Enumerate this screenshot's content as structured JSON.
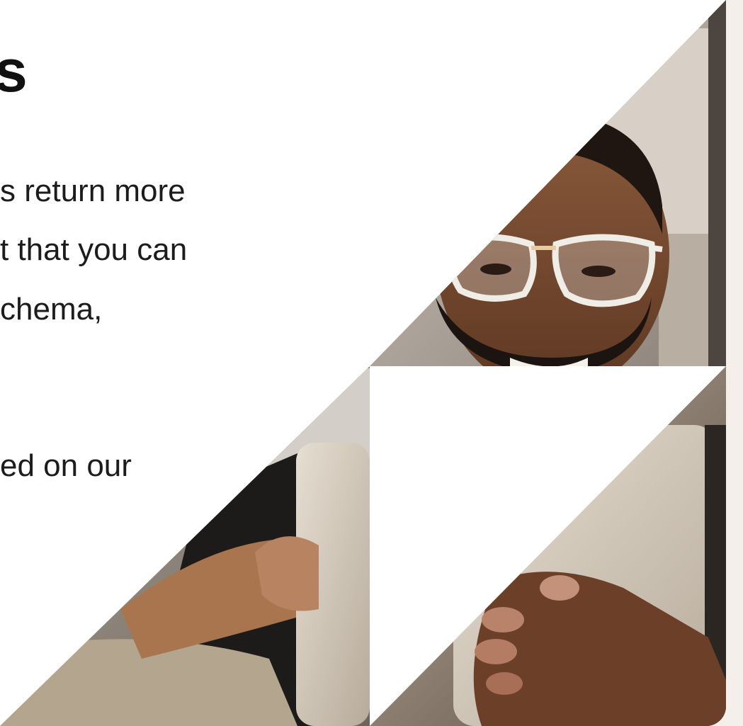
{
  "heading": "s",
  "paragraph": {
    "line1": "s return more",
    "line2": "t that you can",
    "line3": "chema,",
    "line4": "ed on our"
  },
  "colors": {
    "page_background": "#f4efea",
    "card_background": "#ffffff",
    "text": "#1c1c1c"
  },
  "images": [
    {
      "name": "man-with-glasses-photo",
      "description": "smiling man with glasses"
    },
    {
      "name": "hands-holding-tablet-photo",
      "description": "hands holding tablet"
    }
  ]
}
